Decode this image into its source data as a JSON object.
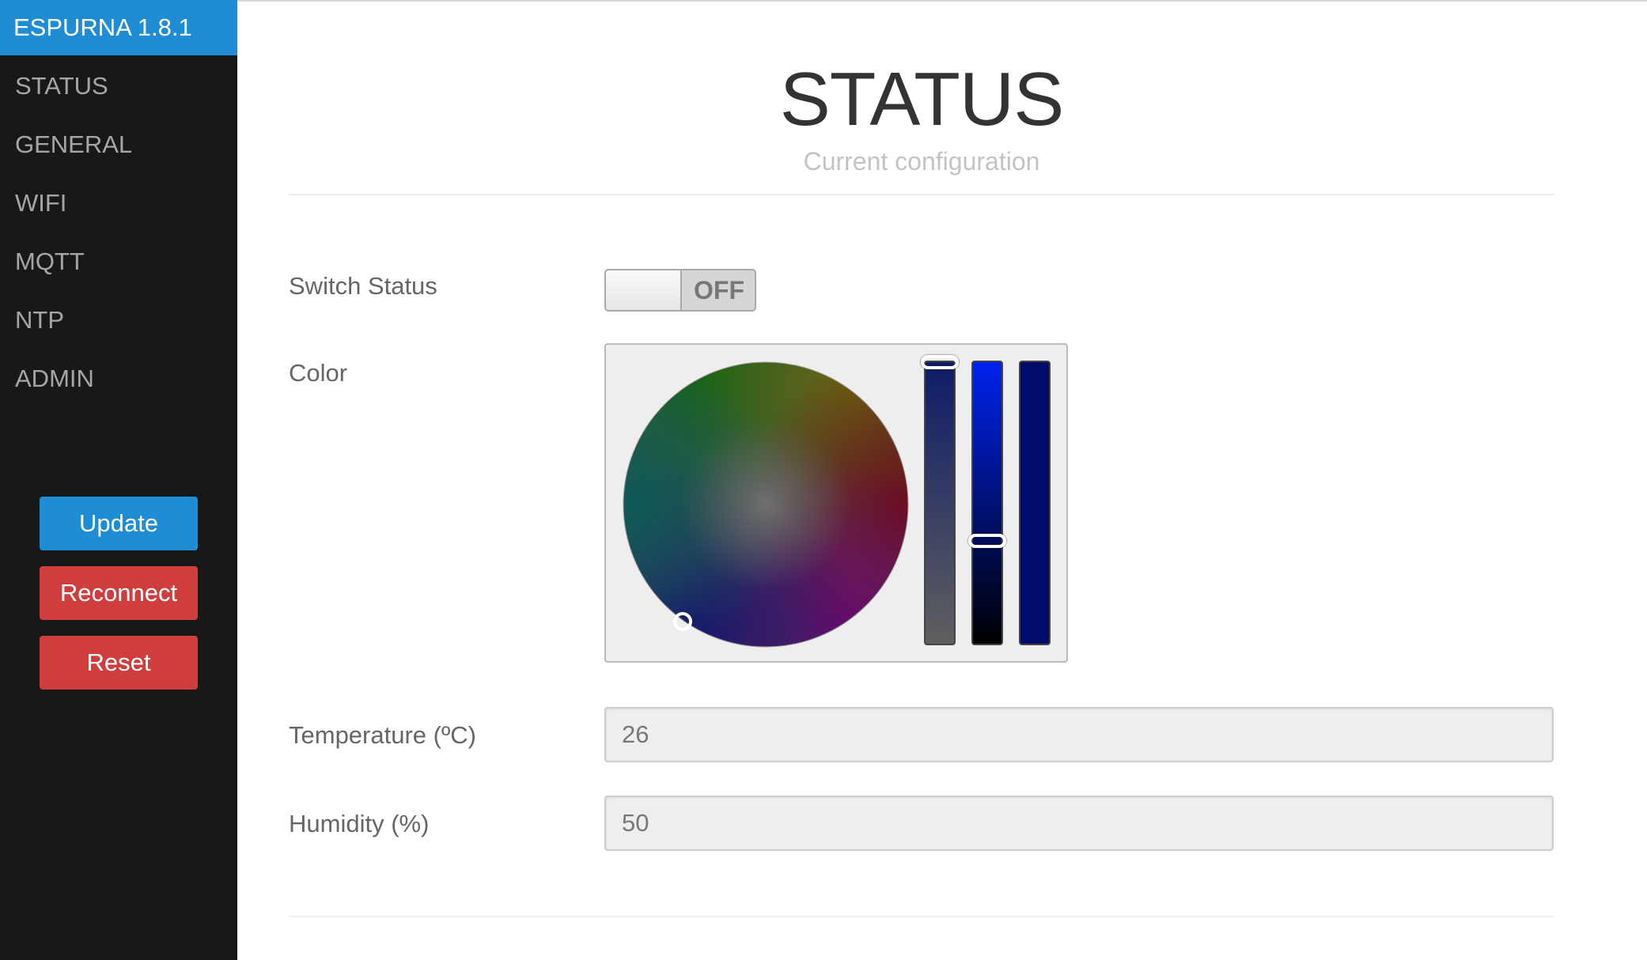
{
  "sidebar": {
    "brand": "ESPURNA 1.8.1",
    "menu": [
      {
        "label": "STATUS"
      },
      {
        "label": "GENERAL"
      },
      {
        "label": "WIFI"
      },
      {
        "label": "MQTT"
      },
      {
        "label": "NTP"
      },
      {
        "label": "ADMIN"
      }
    ],
    "buttons": {
      "update": "Update",
      "reconnect": "Reconnect",
      "reset": "Reset"
    }
  },
  "header": {
    "title": "STATUS",
    "subtitle": "Current configuration"
  },
  "form": {
    "switch": {
      "label": "Switch Status",
      "state": "OFF"
    },
    "color": {
      "label": "Color"
    },
    "temperature": {
      "label": "Temperature (ºC)",
      "value": "26"
    },
    "humidity": {
      "label": "Humidity (%)",
      "value": "50"
    }
  },
  "colors": {
    "brand": "#1f8dd6",
    "sidebar_bg": "#191818",
    "danger": "#cf3d3d"
  }
}
